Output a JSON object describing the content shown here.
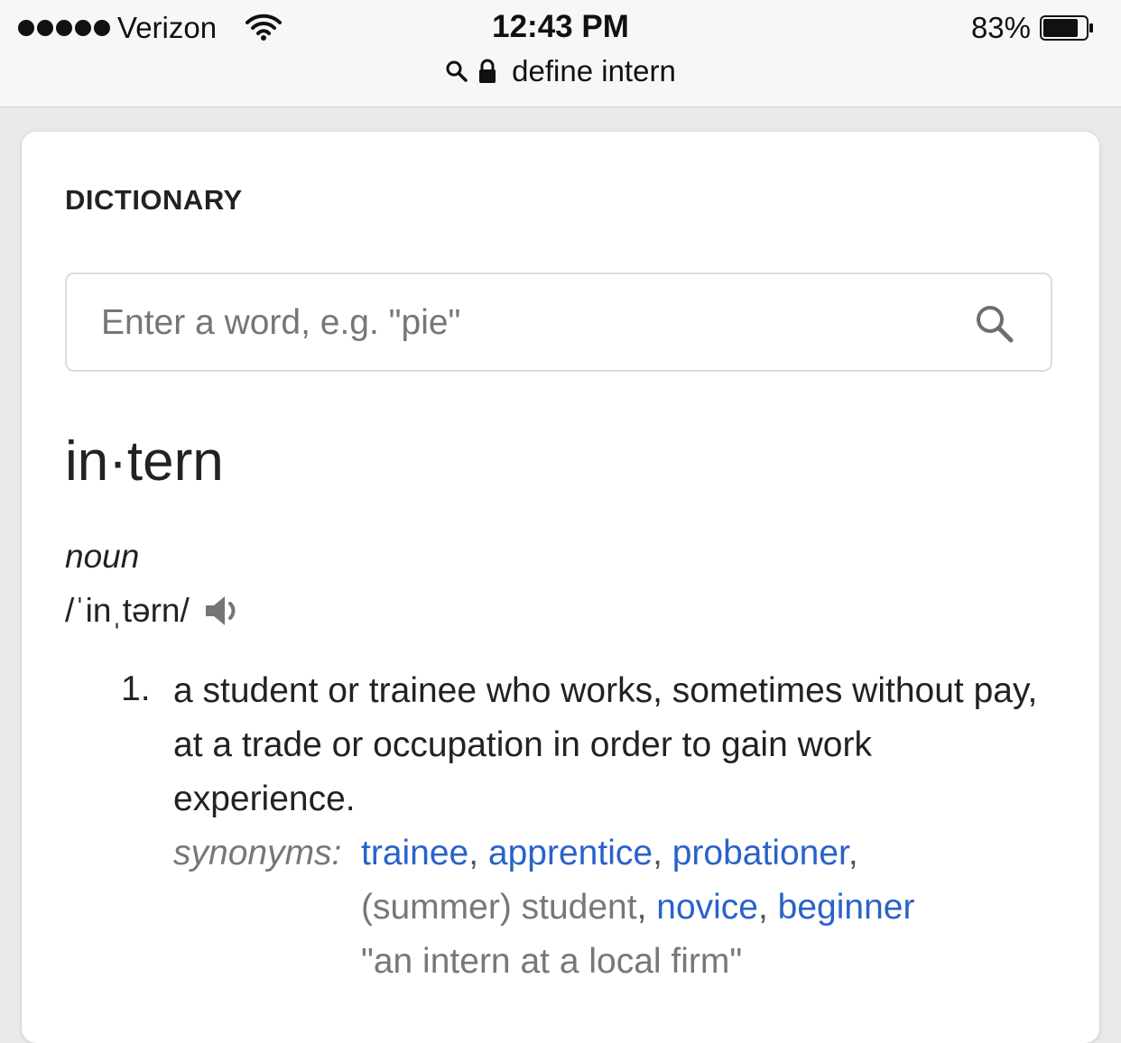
{
  "status_bar": {
    "carrier": "Verizon",
    "time": "12:43 PM",
    "battery_percent": "83%",
    "signal_bars": 5,
    "battery_level": 0.83
  },
  "url_bar": {
    "text": "define intern",
    "icons": [
      "search-icon",
      "lock-icon"
    ]
  },
  "dictionary": {
    "section_label": "DICTIONARY",
    "search_placeholder": "Enter a word, e.g. \"pie\"",
    "search_value": "",
    "headword": "in·tern",
    "part_of_speech": "noun",
    "pronunciation": "/ˈinˌtərn/",
    "senses": [
      {
        "number": "1.",
        "definition": "a student or trainee who works, sometimes without pay, at a trade or occupation in order to gain work experience.",
        "synonyms_label": "synonyms:",
        "synonyms": [
          {
            "text": "trainee",
            "link": true
          },
          {
            "text": "apprentice",
            "link": true
          },
          {
            "text": "probationer",
            "link": true
          },
          {
            "text": "(summer) student",
            "link": false
          },
          {
            "text": "novice",
            "link": true
          },
          {
            "text": "beginner",
            "link": true
          }
        ],
        "example": "\"an intern at a local firm\""
      }
    ]
  },
  "colors": {
    "link": "#2a62c9",
    "text": "#222222",
    "muted": "#777777",
    "status_bg": "#f7f7f7",
    "page_bg": "#e9e9e9"
  }
}
